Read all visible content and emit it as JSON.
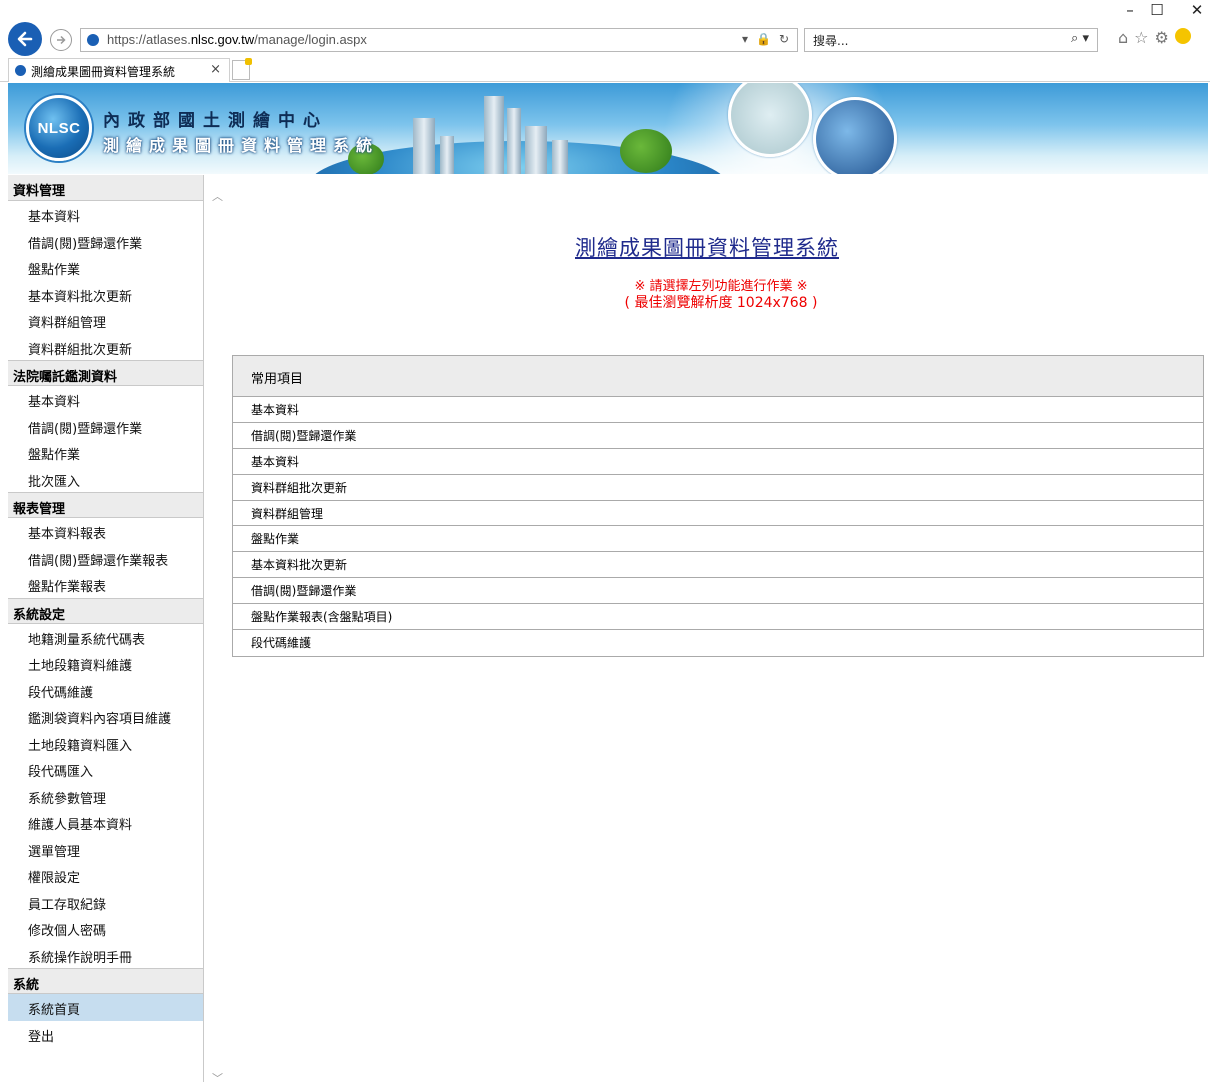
{
  "browser": {
    "url_prefix": "https://atlases.",
    "url_host": "nlsc.gov.tw",
    "url_path": "/manage/login.aspx",
    "search_placeholder": "搜尋...",
    "tab_title": "測繪成果圖冊資料管理系統",
    "tab_close": "×"
  },
  "banner": {
    "logo_text": "NLSC",
    "line1": "內政部國土測繪中心",
    "line2": "測繪成果圖冊資料管理系統"
  },
  "sidebar": {
    "sections": [
      {
        "title": "資料管理",
        "items": [
          "基本資料",
          "借調(閱)暨歸還作業",
          "盤點作業",
          "基本資料批次更新",
          "資料群組管理",
          "資料群組批次更新"
        ]
      },
      {
        "title": "法院囑託鑑測資料",
        "items": [
          "基本資料",
          "借調(閱)暨歸還作業",
          "盤點作業",
          "批次匯入"
        ]
      },
      {
        "title": "報表管理",
        "items": [
          "基本資料報表",
          "借調(閱)暨歸還作業報表",
          "盤點作業報表"
        ]
      },
      {
        "title": "系統設定",
        "items": [
          "地籍測量系統代碼表",
          "土地段籍資料維護",
          "段代碼維護",
          "鑑測袋資料內容項目維護",
          "土地段籍資料匯入",
          "段代碼匯入",
          "系統參數管理",
          "維護人員基本資料",
          "選單管理",
          "權限設定",
          "員工存取紀錄",
          "修改個人密碼",
          "系統操作說明手冊"
        ]
      },
      {
        "title": "系統",
        "items": [
          "系統首頁",
          "登出"
        ]
      }
    ]
  },
  "main": {
    "title": "測繪成果圖冊資料管理系統",
    "notice_line1": "※ 請選擇左列功能進行作業 ※",
    "notice_line2": "( 最佳瀏覽解析度 1024x768 )",
    "common_header": "常用項目",
    "common_items": [
      "基本資料",
      "借調(閱)暨歸還作業",
      "基本資料",
      "資料群組批次更新",
      "資料群組管理",
      "盤點作業",
      "基本資料批次更新",
      "借調(閱)暨歸還作業",
      "盤點作業報表(含盤點項目)",
      "段代碼維護"
    ]
  }
}
